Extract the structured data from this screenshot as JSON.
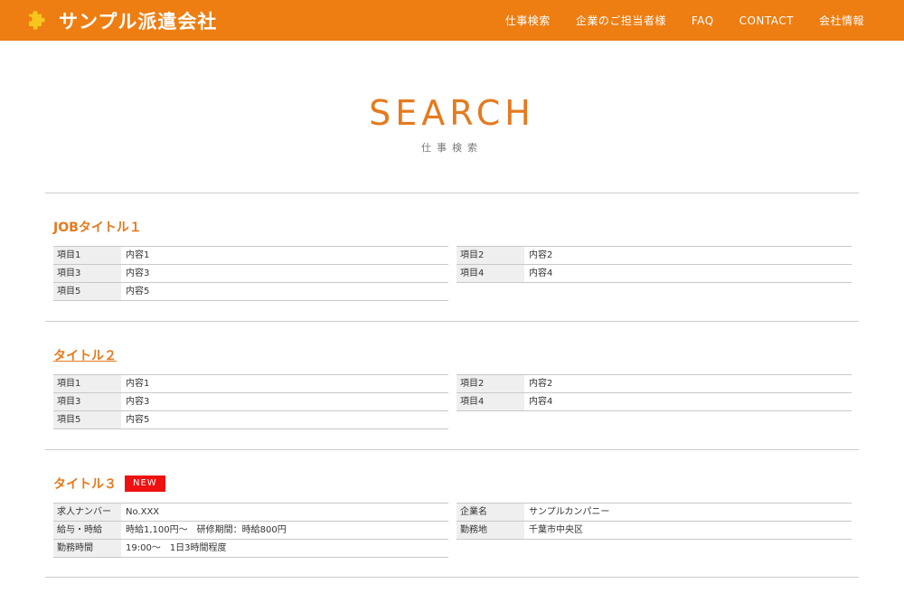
{
  "header": {
    "logo_text": "サンプル派遣会社",
    "brand_color": "#ee7d12",
    "nav": [
      "仕事検索",
      "企業のご担当者様",
      "FAQ",
      "CONTACT",
      "会社情報"
    ]
  },
  "hero": {
    "title": "SEARCH",
    "subtitle": "仕事検索"
  },
  "jobs": [
    {
      "title": "JOBタイトル１",
      "badge": "",
      "left": [
        {
          "k": "項目1",
          "v": "内容1"
        },
        {
          "k": "項目3",
          "v": "内容3"
        },
        {
          "k": "項目5",
          "v": "内容5"
        }
      ],
      "right": [
        {
          "k": "項目2",
          "v": "内容2"
        },
        {
          "k": "項目4",
          "v": "内容4"
        }
      ]
    },
    {
      "title": "タイトル２",
      "badge": "",
      "left": [
        {
          "k": "項目1",
          "v": "内容1"
        },
        {
          "k": "項目3",
          "v": "内容3"
        },
        {
          "k": "項目5",
          "v": "内容5"
        }
      ],
      "right": [
        {
          "k": "項目2",
          "v": "内容2"
        },
        {
          "k": "項目4",
          "v": "内容4"
        }
      ]
    },
    {
      "title": "タイトル３",
      "badge": "NEW",
      "left": [
        {
          "k": "求人ナンバー",
          "v": "No.XXX"
        },
        {
          "k": "給与・時給",
          "v": "時給1,100円〜　研修期間：時給800円"
        },
        {
          "k": "勤務時間",
          "v": "19:00〜　1日3時間程度"
        }
      ],
      "right": [
        {
          "k": "企業名",
          "v": "サンプルカンパニー"
        },
        {
          "k": "勤務地",
          "v": "千葉市中央区"
        }
      ]
    }
  ]
}
